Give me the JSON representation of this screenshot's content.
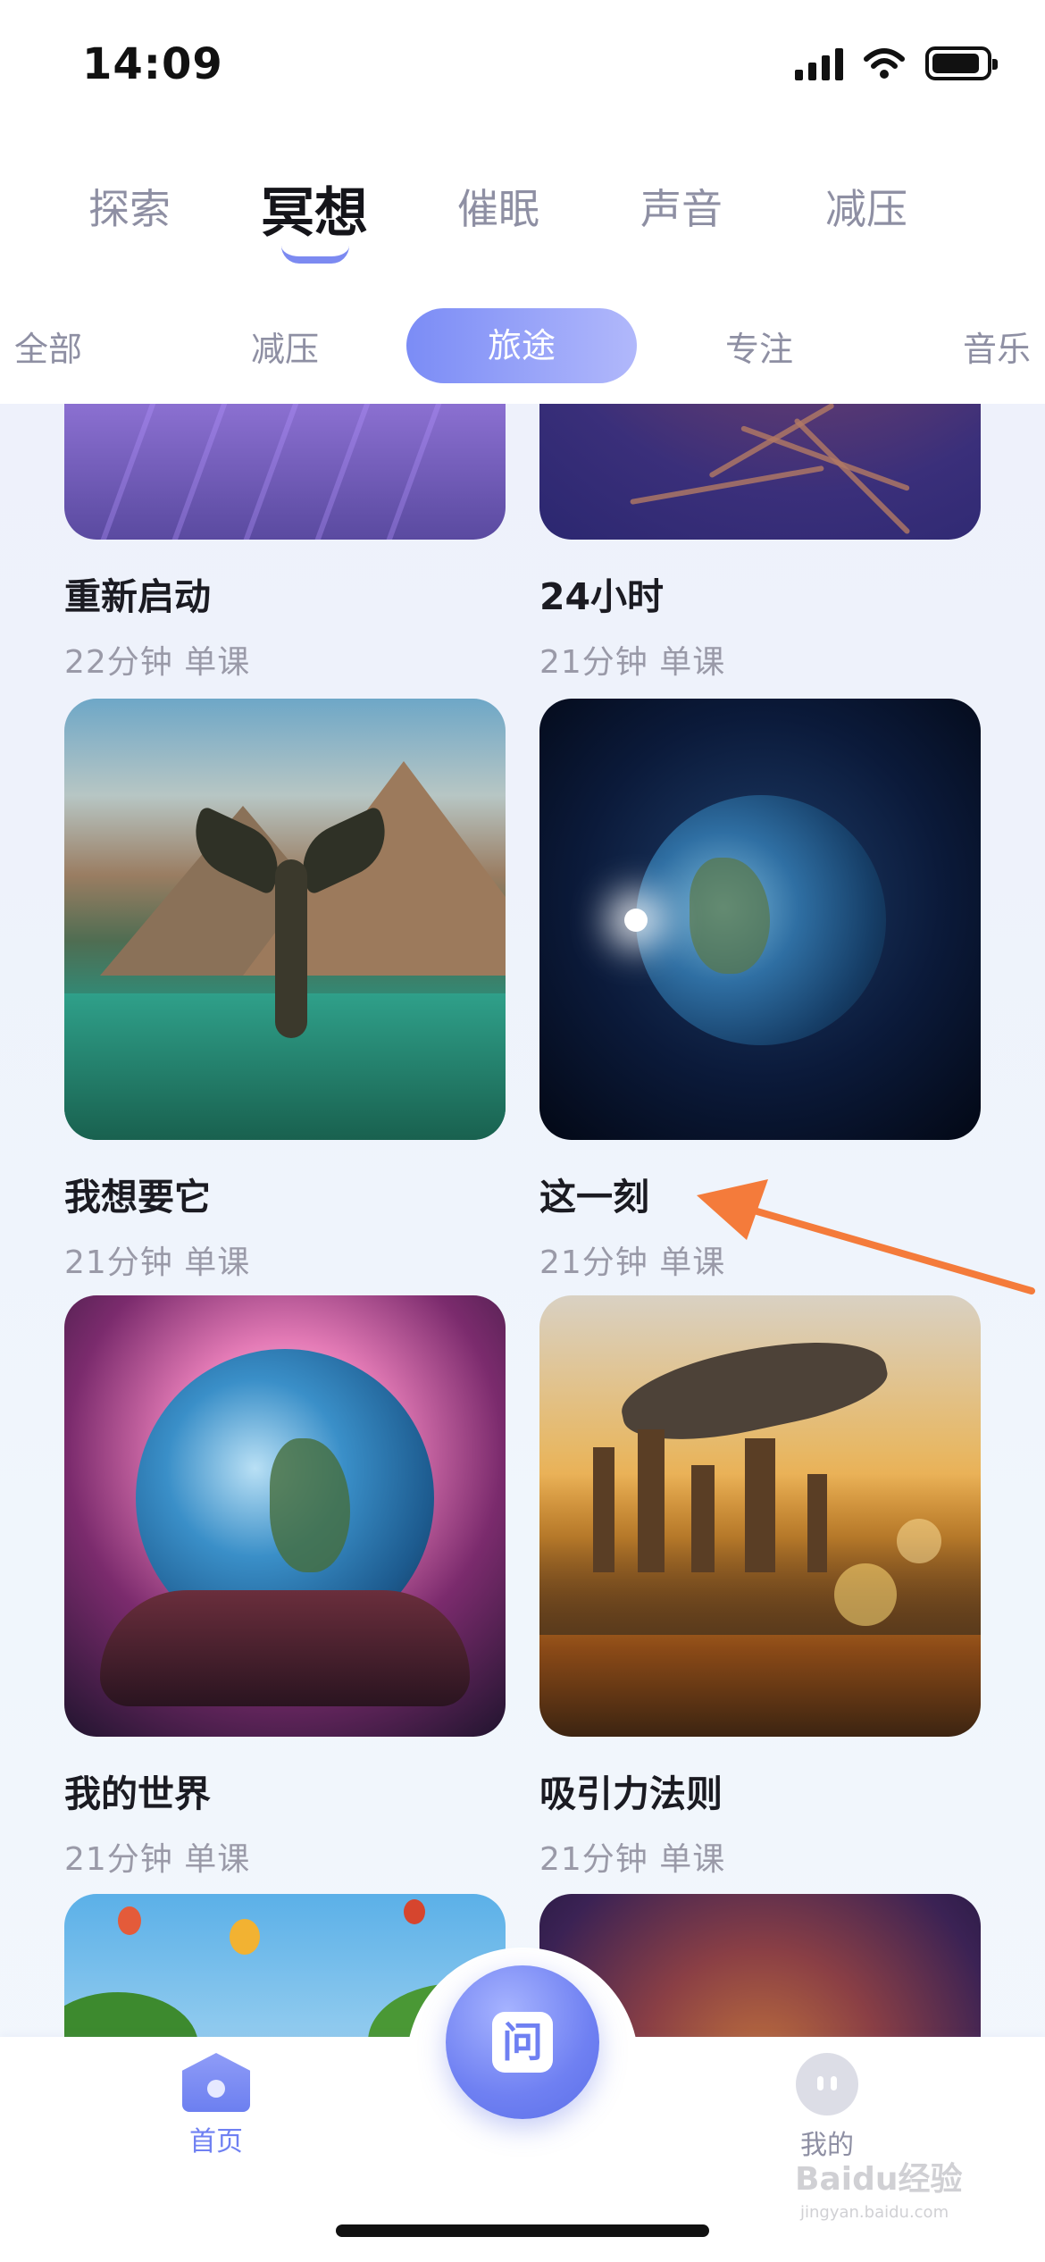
{
  "status_bar": {
    "time": "14:09",
    "battery_level": 0.9
  },
  "main_tabs": [
    {
      "label": "探索",
      "active": false
    },
    {
      "label": "冥想",
      "active": true
    },
    {
      "label": "催眠",
      "active": false
    },
    {
      "label": "声音",
      "active": false
    },
    {
      "label": "减压",
      "active": false
    }
  ],
  "sub_tabs": [
    {
      "label": "全部",
      "active": false
    },
    {
      "label": "减压",
      "active": false
    },
    {
      "label": "旅途",
      "active": true
    },
    {
      "label": "专注",
      "active": false
    },
    {
      "label": "音乐",
      "active": false
    }
  ],
  "cards": [
    {
      "title": "重新启动",
      "meta": "22分钟 单课",
      "image": "lavender-field"
    },
    {
      "title": "24小时",
      "meta": "21分钟 单课",
      "image": "tree-roots"
    },
    {
      "title": "我想要它",
      "meta": "21分钟 单课",
      "image": "whale-tail-lake"
    },
    {
      "title": "这一刻",
      "meta": "21分钟 单课",
      "image": "earth-in-space"
    },
    {
      "title": "我的世界",
      "meta": "21分钟 单课",
      "image": "earth-in-hands"
    },
    {
      "title": "吸引力法则",
      "meta": "21分钟 单课",
      "image": "whale-over-city"
    },
    {
      "title": "",
      "meta": "",
      "image": "hot-air-balloons"
    },
    {
      "title": "",
      "meta": "",
      "image": "nebula"
    }
  ],
  "bottom_nav": {
    "home_label": "首页",
    "center_glyph": "问",
    "me_label": "我的"
  },
  "watermark": {
    "text": "Baidu经验",
    "sub": "jingyan.baidu.com"
  },
  "colors": {
    "accent": "#7c8af1",
    "arrow": "#f47b3b",
    "muted_text": "#9a9aa8"
  }
}
